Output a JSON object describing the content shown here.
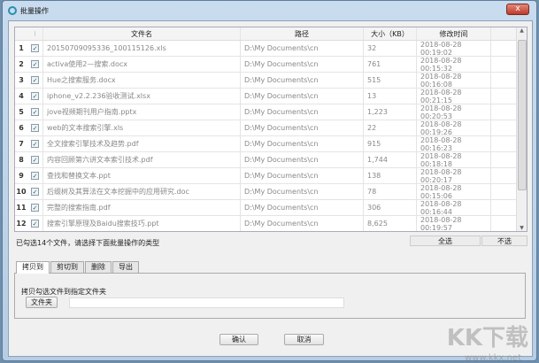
{
  "window": {
    "title": "批量操作",
    "close": "x"
  },
  "table": {
    "headers": {
      "name": "文件名",
      "path": "路径",
      "size": "大小（KB）",
      "modified": "修改时间"
    },
    "rows": [
      {
        "n": "1",
        "name": "20150709095336_100115126.xls",
        "path": "D:\\My Documents\\cn",
        "size": "32",
        "modified": "2018-08-28 00:19:02"
      },
      {
        "n": "2",
        "name": "activa使用2—搜索.docx",
        "path": "D:\\My Documents\\cn",
        "size": "761",
        "modified": "2018-08-28 00:15:32"
      },
      {
        "n": "3",
        "name": "Hue之搜索服务.docx",
        "path": "D:\\My Documents\\cn",
        "size": "515",
        "modified": "2018-08-28 00:16:08"
      },
      {
        "n": "4",
        "name": "iphone_v2.2.236验收测试.xlsx",
        "path": "D:\\My Documents\\cn",
        "size": "13",
        "modified": "2018-08-28 00:21:15"
      },
      {
        "n": "5",
        "name": "jove视频期刊用户指南.pptx",
        "path": "D:\\My Documents\\cn",
        "size": "1,223",
        "modified": "2018-08-28 00:20:53"
      },
      {
        "n": "6",
        "name": "web的文本搜索引擎.xls",
        "path": "D:\\My Documents\\cn",
        "size": "22",
        "modified": "2018-08-28 00:19:26"
      },
      {
        "n": "7",
        "name": "全文搜索引擎技术及趋势.pdf",
        "path": "D:\\My Documents\\cn",
        "size": "915",
        "modified": "2018-08-28 00:16:23"
      },
      {
        "n": "8",
        "name": "内容回顾第六讲文本索引技术.pdf",
        "path": "D:\\My Documents\\cn",
        "size": "1,744",
        "modified": "2018-08-28 00:18:18"
      },
      {
        "n": "9",
        "name": "查找和替换文本.ppt",
        "path": "D:\\My Documents\\cn",
        "size": "138",
        "modified": "2018-08-28 00:20:17"
      },
      {
        "n": "10",
        "name": "后缀树及其算法在文本挖掘中的应用研究.doc",
        "path": "D:\\My Documents\\cn",
        "size": "78",
        "modified": "2018-08-28 00:15:06"
      },
      {
        "n": "11",
        "name": "完整的搜索指南.pdf",
        "path": "D:\\My Documents\\cn",
        "size": "306",
        "modified": "2018-08-28 00:16:44"
      },
      {
        "n": "12",
        "name": "搜索引擎原理及Baidu搜索技巧.ppt",
        "path": "D:\\My Documents\\cn",
        "size": "8,625",
        "modified": "2018-08-28 00:19:57"
      }
    ]
  },
  "status": "已勾选14个文件，请选择下面批量操作的类型",
  "select_all": "全选",
  "select_none": "不选",
  "tabs": [
    "拷贝到",
    "剪切到",
    "删除",
    "导出"
  ],
  "panel": {
    "label": "拷贝勾选文件到指定文件夹",
    "folder_button": "文件夹",
    "folder_value": ""
  },
  "confirm": "确认",
  "cancel": "取消",
  "watermark": "KK下载",
  "watermark_url": "www.kkx.net"
}
